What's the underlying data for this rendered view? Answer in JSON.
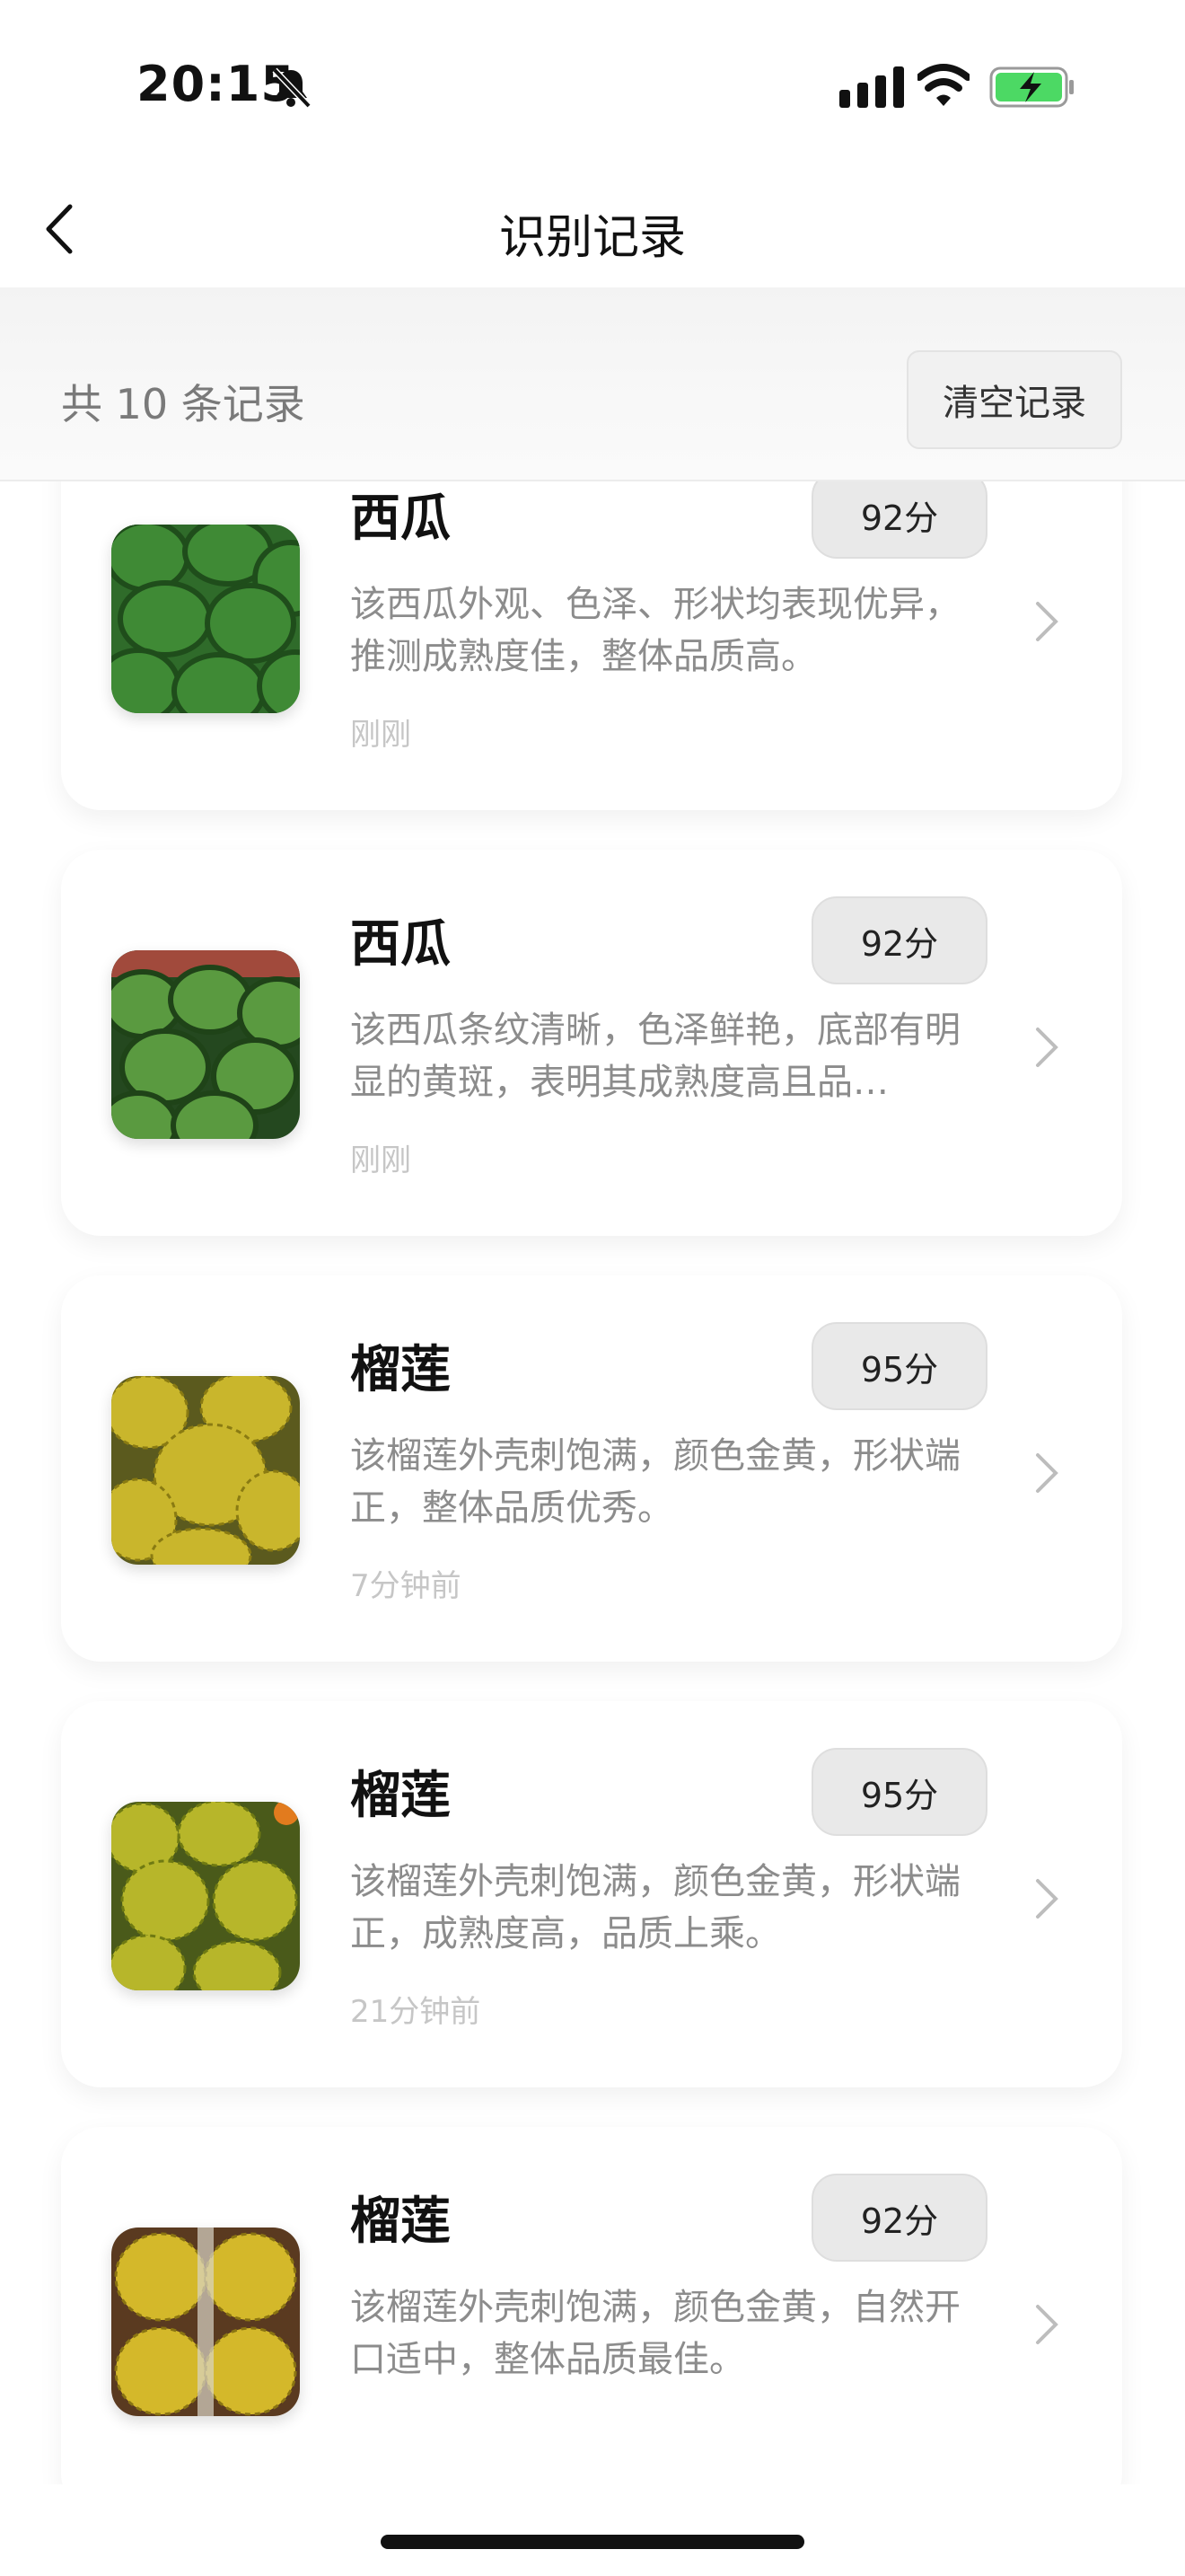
{
  "status_bar": {
    "time": "20:15",
    "icons": [
      "bell-slash-icon",
      "signal-icon",
      "wifi-icon",
      "battery-charging-icon"
    ]
  },
  "nav": {
    "title": "识别记录",
    "back_icon": "chevron-left-icon"
  },
  "summary": {
    "count_text": "共 10 条记录",
    "clear_label": "清空记录"
  },
  "records": [
    {
      "name": "西瓜",
      "score": "92分",
      "description": "该西瓜外观、色泽、形状均表现优异，推测成熟度佳，整体品质高。",
      "time": "刚刚",
      "image": "watermelon"
    },
    {
      "name": "西瓜",
      "score": "92分",
      "description": "该西瓜条纹清晰，色泽鲜艳，底部有明显的黄斑，表明其成熟度高且品…",
      "time": "刚刚",
      "image": "watermelon"
    },
    {
      "name": "榴莲",
      "score": "95分",
      "description": "该榴莲外壳刺饱满，颜色金黄，形状端正，整体品质优秀。",
      "time": "7分钟前",
      "image": "durian"
    },
    {
      "name": "榴莲",
      "score": "95分",
      "description": "该榴莲外壳刺饱满，颜色金黄，形状端正，成熟度高，品质上乘。",
      "time": "21分钟前",
      "image": "durian"
    },
    {
      "name": "榴莲",
      "score": "92分",
      "description": "该榴莲外壳刺饱满，颜色金黄，自然开口适中，整体品质最佳。",
      "time": "",
      "image": "durian"
    }
  ],
  "colors": {
    "background": "#ffffff",
    "summary_bg": "#f5f5f5",
    "badge_bg": "#e9e9e9",
    "secondary_text": "#8c8c8c",
    "battery_green": "#4cd964"
  }
}
